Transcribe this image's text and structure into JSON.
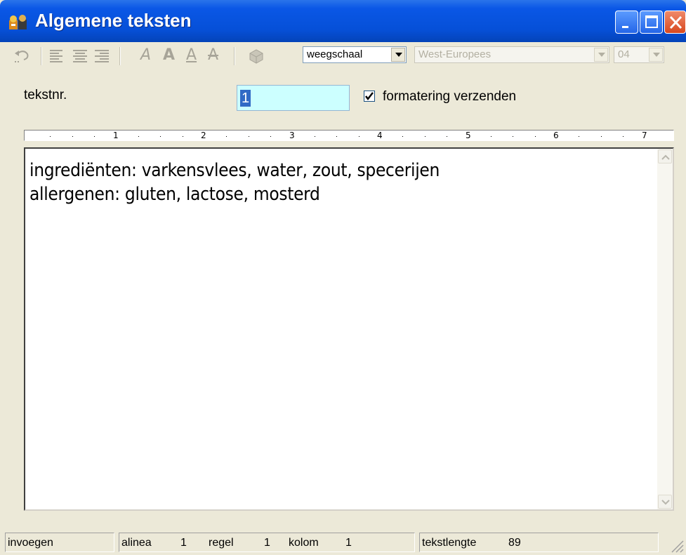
{
  "window": {
    "title": "Algemene teksten",
    "icon": "app-icon"
  },
  "title_buttons": [
    "minimize-icon",
    "maximize-icon",
    "close-icon"
  ],
  "toolbar": {
    "tools": [
      "undo-icon",
      "align-left-icon",
      "align-center-icon",
      "align-right-icon",
      "italic-icon",
      "bold-icon",
      "underline-icon",
      "strikethrough-icon",
      "send-icon"
    ],
    "font_glyph": "A",
    "target_select": "weegschaal",
    "charset_select": "West-Europees",
    "code_select": "04"
  },
  "form": {
    "text_number_label": "tekstnr.",
    "text_number_value": "1",
    "format_checkbox_label": "formatering verzenden",
    "format_checked": true
  },
  "ruler": {
    "marks": [
      "1",
      "2",
      "3",
      "4",
      "5",
      "6",
      "7"
    ]
  },
  "editor": {
    "lines": [
      "ingrediënten: varkensvlees, water, zout, specerijen",
      "allergenen: gluten, lactose, mosterd"
    ]
  },
  "status": {
    "mode": "invoegen",
    "paragraph_label": "alinea",
    "paragraph_value": "1",
    "line_label": "regel",
    "line_value": "1",
    "column_label": "kolom",
    "column_value": "1",
    "length_label": "tekstlengte",
    "length_value": "89"
  },
  "colors": {
    "titlebar": "#0650d8",
    "input_bg": "#ccffff",
    "window_bg": "#ece9d8"
  }
}
